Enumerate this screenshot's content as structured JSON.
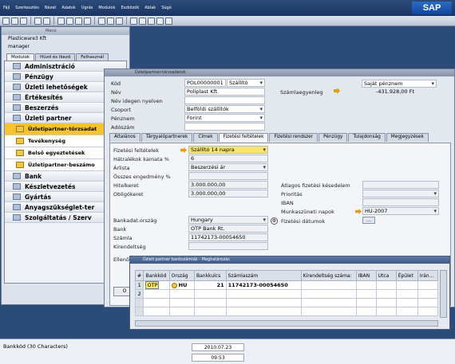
{
  "menu": [
    "Fájl",
    "Szerkesztés",
    "Nézet",
    "Adatok",
    "Ugrás",
    "Modulok",
    "Eszközök",
    "Ablak",
    "Súgó"
  ],
  "main_window": {
    "title": "Menü",
    "company": "Plasticware3 Kft",
    "user": "manager",
    "tabs": [
      "Modulok",
      "Húzd és Ikezd",
      "Felhasznál"
    ],
    "modules": [
      {
        "label": "Adminisztráció",
        "type": "module"
      },
      {
        "label": "Pénzügy",
        "type": "module"
      },
      {
        "label": "Üzleti lehetőségek",
        "type": "module"
      },
      {
        "label": "Értékesítés",
        "type": "module"
      },
      {
        "label": "Beszerzés",
        "type": "module"
      },
      {
        "label": "Üzleti partner",
        "type": "module"
      },
      {
        "label": "Üzletipartner-törzsadat",
        "type": "sub-active"
      },
      {
        "label": "Tevékenység",
        "type": "sub"
      },
      {
        "label": "Belső egyeztetések",
        "type": "sub"
      },
      {
        "label": "Üzletipartner-beszámo",
        "type": "sub"
      },
      {
        "label": "Bank",
        "type": "module"
      },
      {
        "label": "Készletvezetés",
        "type": "module"
      },
      {
        "label": "Gyártás",
        "type": "module"
      },
      {
        "label": "Anyagszükséglet-ter",
        "type": "module"
      },
      {
        "label": "Szolgáltatás / Szerv",
        "type": "module"
      }
    ]
  },
  "partner_window": {
    "title": "Üzletipartner-törzsadatok",
    "fields": {
      "kod_label": "Kód",
      "kod_value": "POL00000001",
      "kod_type": "Szállító",
      "nev_label": "Név",
      "nev_value": "Poliplast Kft.",
      "nev_idegen_label": "Név idegen nyelven",
      "csoport_label": "Csoport",
      "csoport_value": "Belföldi szállítók",
      "penznem_label": "Pénznem",
      "penznem_value": "Forint",
      "adoszam_label": "Adószám",
      "szamla_label": "Számlaegyenleg",
      "sajat_penznem": "Saját pénznem",
      "egyenleg": "-431.928,00",
      "egyenleg_unit": "Ft"
    },
    "tabs": [
      "Általános",
      "Tárgyalópartnerek",
      "Címek",
      "Fizetési feltételek",
      "Fizetési rendszer",
      "Pénzügy",
      "Tulajdonság",
      "Megjegyzések"
    ],
    "active_tab": "Fizetési feltételek",
    "payment": {
      "fiz_felt_label": "Fizetési feltételek",
      "fiz_felt_value": "Szállító 14 napra",
      "hatralek_label": "Hátralékok kamata %",
      "hatralek_value": "6",
      "arlista_label": "Árlista",
      "arlista_value": "Beszerzési ár",
      "osszes_label": "Összes engedmény %",
      "hitelkeret_label": "Hitelkeret",
      "hitelkeret_value": "3.000.000,00",
      "obligo_label": "Obligókeret",
      "obligo_value": "3.000.000,00",
      "atlagos_label": "Átlagos fizetési késedelem",
      "prioritas_label": "Prioritás",
      "iban_label": "IBAN",
      "munkaszuneti_label": "Munkaszüneti napok",
      "munkaszuneti_value": "HU-2007",
      "fizetesi_datumok_label": "Fizetési dátumok",
      "bankorszag_label": "Bankadat.ország",
      "bankorszag_value": "Hungary",
      "bank_label": "Bank",
      "bank_value": "OTP Bank Rt.",
      "szamla_label": "Számla",
      "szamla_value": "11742173-00054650",
      "kirendelt_label": "Kirendeltség",
      "ellenorzo_label": "Ellenő"
    }
  },
  "bank_dialog": {
    "title": "Üzleti partner bankszámlák - Meghatározás",
    "columns": [
      "#",
      "Bankkód",
      "Ország",
      "Bankkulcs",
      "Számlaszám",
      "Kirendeltség száma:",
      "IBAN",
      "Utca",
      "Épület",
      "Irán..."
    ],
    "rows": [
      {
        "num": "1",
        "bankkod": "OTP",
        "orszag": "HU",
        "bankkulcs": "21",
        "szamlaszam": "11742173-00054650"
      },
      {
        "num": "2"
      }
    ]
  },
  "status": {
    "field_info": "Bankkód (30 Characters)",
    "date": "2010.07.23",
    "time": "09:53"
  },
  "colors": {
    "title_bar": "#2c4b7a",
    "active_yellow": "#f7c430",
    "field_yellow": "#f8e56a"
  }
}
